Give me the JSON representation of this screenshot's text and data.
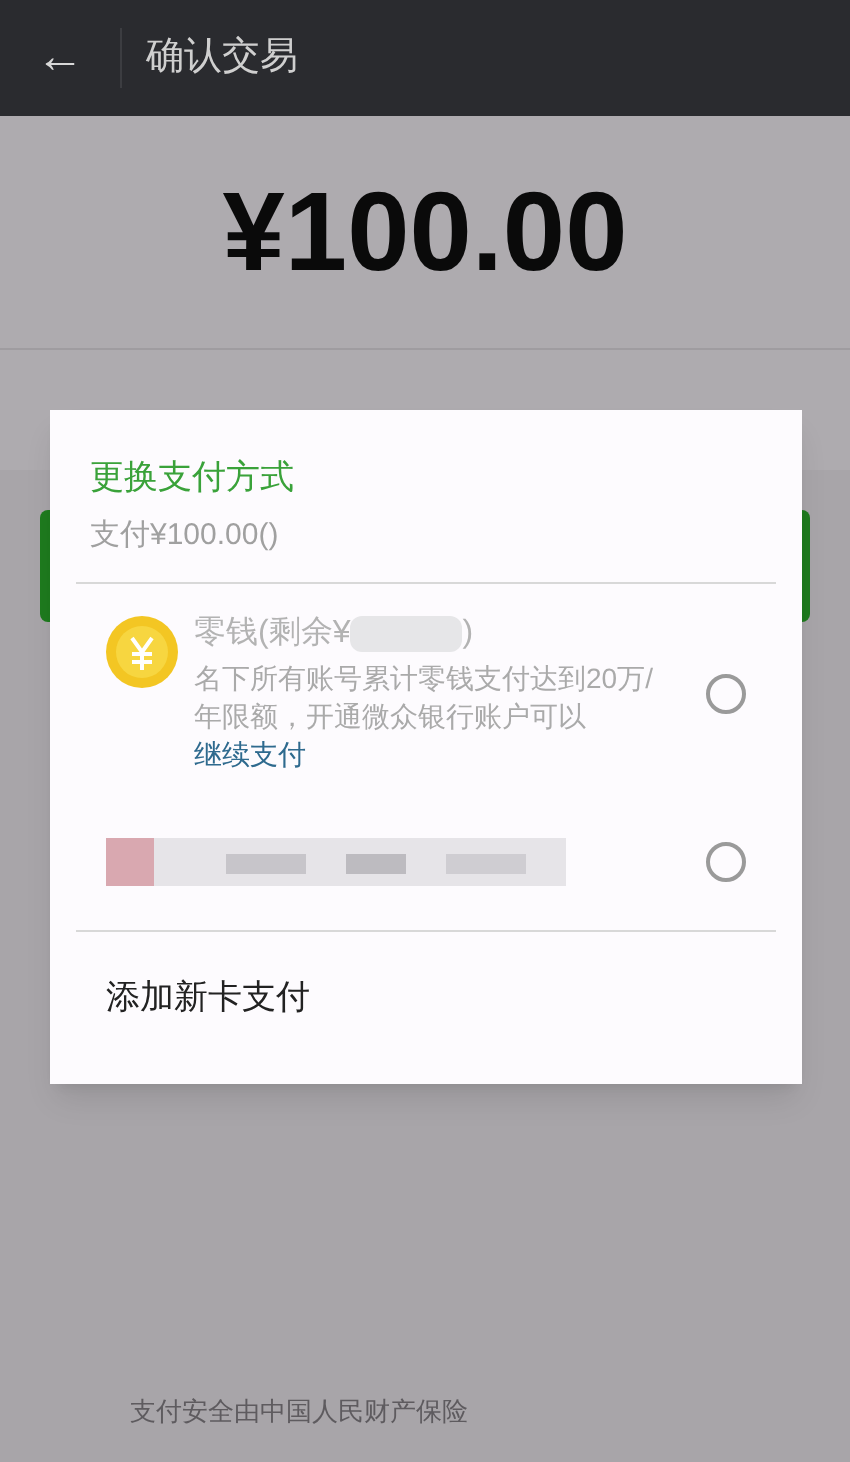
{
  "header": {
    "back_icon": "←",
    "title": "确认交易"
  },
  "amount": "¥100.00",
  "dialog": {
    "title": "更换支付方式",
    "subtitle": "支付¥100.00()",
    "options": [
      {
        "kind": "balance",
        "label_start": "零钱(剩余¥",
        "label_end": ")",
        "note": "名下所有账号累计零钱支付达到20万/年限额，开通微众银行账户可以",
        "link": "继续支付",
        "selected": false
      },
      {
        "kind": "card",
        "selected": false
      }
    ],
    "add_card": "添加新卡支付"
  },
  "footer": "支付安全由中国人民财产保险"
}
